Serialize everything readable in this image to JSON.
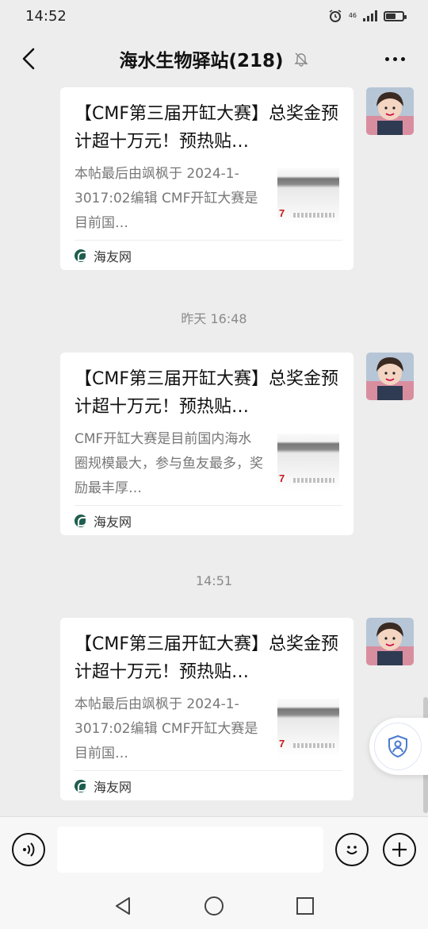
{
  "status": {
    "time": "14:52",
    "network": "46",
    "battery_level": 0.55
  },
  "header": {
    "title": "海水生物驿站(218)"
  },
  "timestamps": [
    "昨天 16:48",
    "14:51"
  ],
  "messages": [
    {
      "title": "【CMF第三届开缸大赛】总奖金预计超十万元！预热贴…",
      "description": "本帖最后由飒枫于 2024-1-3017:02编辑 CMF开缸大赛是目前国…",
      "thumb_mark": "7",
      "source": "海友网"
    },
    {
      "title": "【CMF第三届开缸大赛】总奖金预计超十万元！预热贴…",
      "description": "CMF开缸大赛是目前国内海水圈规模最大，参与鱼友最多，奖励最丰厚…",
      "thumb_mark": "7",
      "source": "海友网"
    },
    {
      "title": "【CMF第三届开缸大赛】总奖金预计超十万元！预热贴…",
      "description": "本帖最后由飒枫于 2024-1-3017:02编辑 CMF开缸大赛是目前国…",
      "thumb_mark": "7",
      "source": "海友网"
    }
  ],
  "input": {
    "value": "",
    "placeholder": ""
  },
  "icons": {
    "back": "chevron-left-icon",
    "mute": "bell-off-icon",
    "more": "more-dots-icon",
    "voice": "voice-icon",
    "emoji": "emoji-icon",
    "plus": "plus-icon",
    "shield": "shield-person-icon"
  },
  "colors": {
    "background": "#ededed",
    "card": "#ffffff",
    "accent": "#4a7bd0"
  }
}
